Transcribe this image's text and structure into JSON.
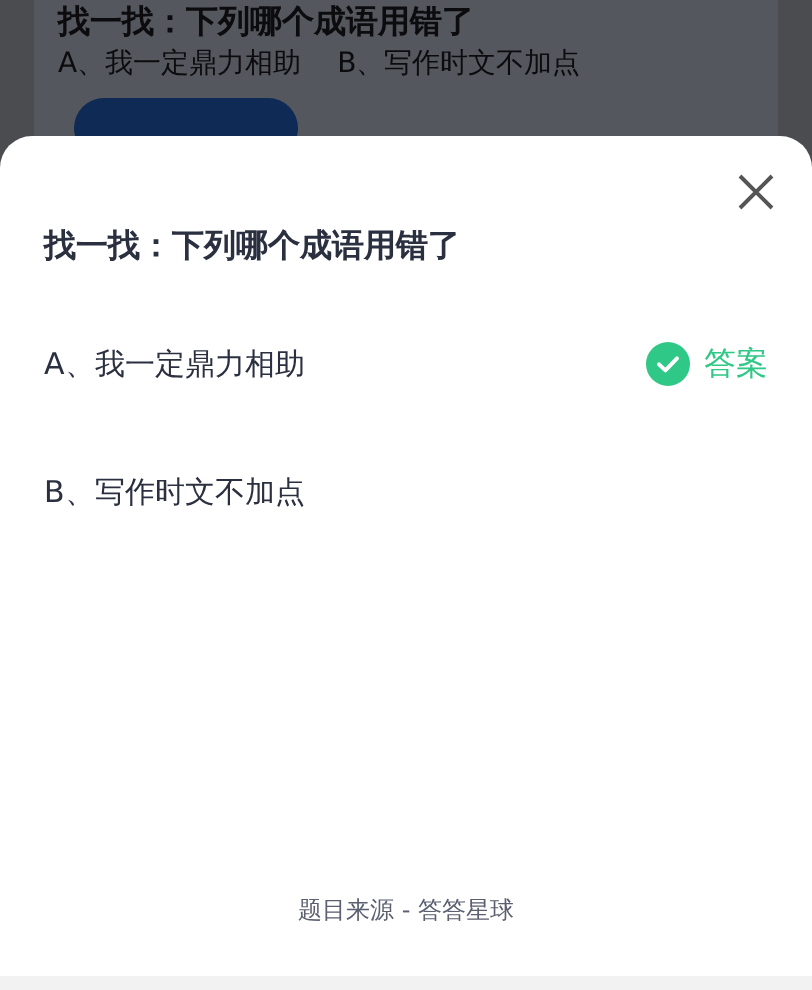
{
  "background_card": {
    "title": "找一找：下列哪个成语用错了",
    "options": [
      "A、我一定鼎力相助",
      "B、写作时文不加点"
    ]
  },
  "sheet": {
    "title": "找一找：下列哪个成语用错了",
    "options": [
      {
        "text": "A、我一定鼎力相助",
        "is_answer": true,
        "answer_label": "答案"
      },
      {
        "text": "B、写作时文不加点",
        "is_answer": false
      }
    ],
    "footer": "题目来源 - 答答星球"
  }
}
